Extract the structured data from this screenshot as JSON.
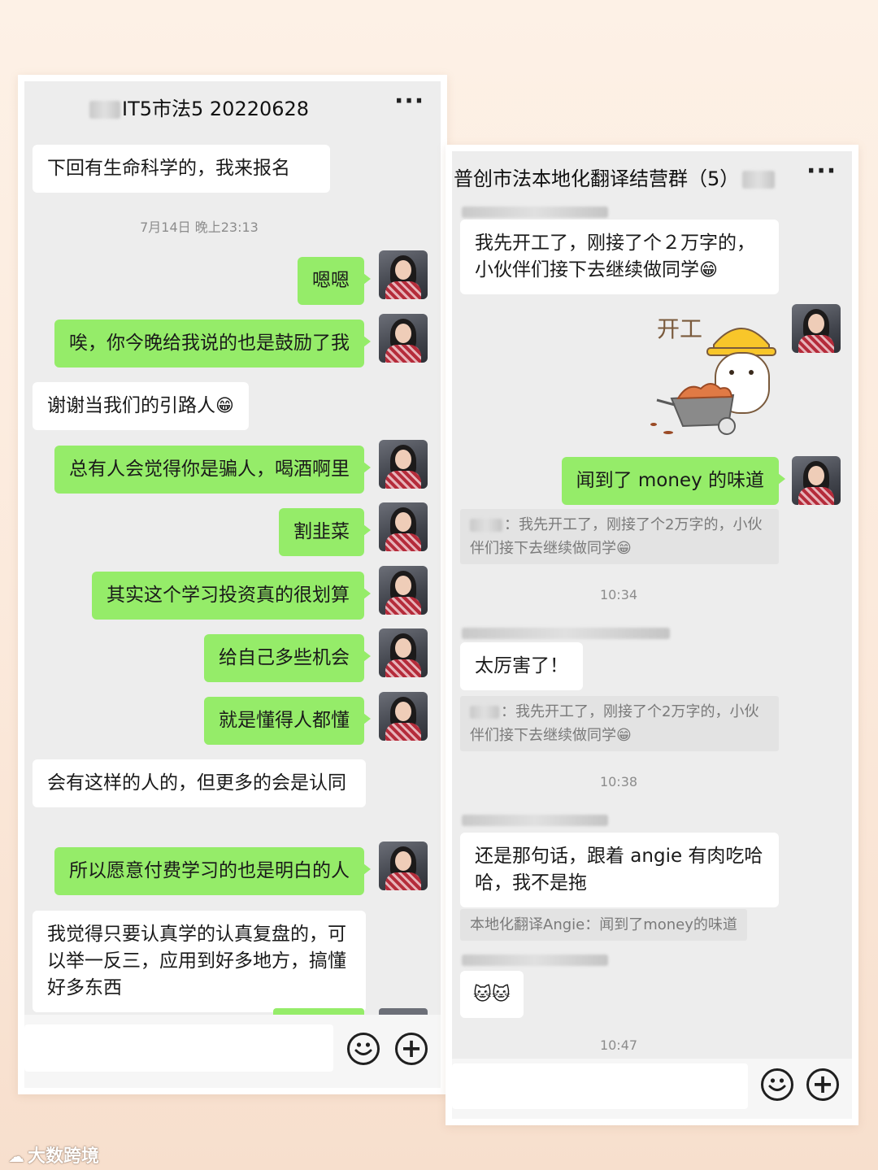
{
  "colors": {
    "chat_background": "#ededed",
    "sent_bubble": "#95ec69",
    "received_bubble": "#ffffff",
    "page_background": "#fbe9db"
  },
  "left_chat": {
    "title": "IT5市法5 20220628",
    "more_icon": "more-icon",
    "messages": [
      {
        "text": "下回有生命科学的，我来报名",
        "side": "received"
      },
      {
        "text": "嗯嗯",
        "side": "sent"
      },
      {
        "text": "唉，你今晚给我说的也是鼓励了我",
        "side": "sent"
      },
      {
        "text": "谢谢当我们的引路人",
        "emoji": "😁",
        "side": "received"
      },
      {
        "text": "总有人会觉得你是骗人，喝酒啊里",
        "side": "sent"
      },
      {
        "text": "割韭菜",
        "side": "sent"
      },
      {
        "text": "其实这个学习投资真的很划算",
        "side": "sent"
      },
      {
        "text": "给自己多些机会",
        "side": "sent"
      },
      {
        "text": "就是懂得人都懂",
        "side": "sent"
      },
      {
        "text": "会有这样的人的，但更多的会是认同",
        "side": "received"
      },
      {
        "text": "所以愿意付费学习的也是明白的人",
        "side": "sent"
      },
      {
        "text": "我觉得只要认真学的认真复盘的，可以举一反三，应用到好多地方，搞懂好多东西",
        "side": "received"
      }
    ],
    "timestamp": "7月14日 晚上23:13",
    "emoji_button": "emoji-icon",
    "plus_button": "plus-icon"
  },
  "right_chat": {
    "title": "普创市法本地化翻译结营群（5）",
    "more_icon": "more-icon",
    "messages": [
      {
        "text": "我先开工了，刚接了个２万字的，小伙伴们接下去继续做同学",
        "emoji": "😁",
        "side": "received"
      },
      {
        "sticker": "开工",
        "side": "sent"
      },
      {
        "text": "闻到了 money 的味道",
        "side": "sent"
      },
      {
        "quote": "：我先开工了，刚接了个2万字的，小伙伴们接下去继续做同学",
        "emoji": "😁"
      },
      {
        "text": "太厉害了！",
        "side": "received"
      },
      {
        "quote": "：我先开工了，刚接了个2万字的，小伙伴们接下去继续做同学",
        "emoji": "😁"
      },
      {
        "text": "还是那句话，跟着 angie 有肉吃哈哈，我不是拖",
        "side": "received"
      },
      {
        "quote": "本地化翻译Angie：闻到了money的味道"
      },
      {
        "text": "",
        "emoji": "🐱🐱",
        "side": "received"
      }
    ],
    "timestamps": [
      "10:34",
      "10:38",
      "10:47"
    ],
    "emoji_button": "emoji-icon",
    "plus_button": "plus-icon"
  },
  "watermark": {
    "logo": "☁",
    "text": "大数跨境"
  }
}
